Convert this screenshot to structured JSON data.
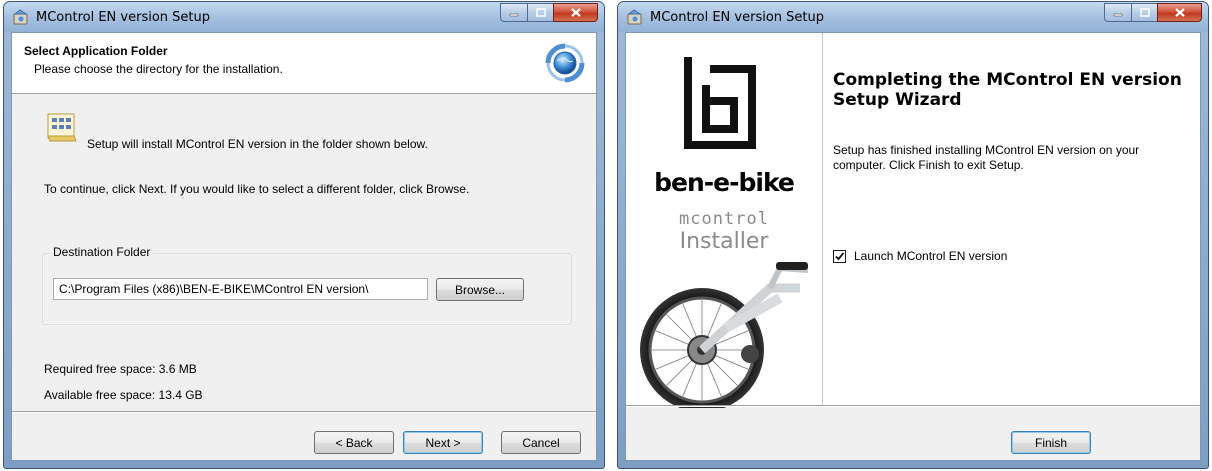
{
  "window1": {
    "title": "MControl EN version Setup",
    "header": {
      "title": "Select Application Folder",
      "subtitle": "Please choose the directory for the installation."
    },
    "intro": "Setup will install MControl EN version in the folder shown below.",
    "instruction": "To continue, click Next. If you would like to select a different folder, click Browse.",
    "destination": {
      "label": "Destination Folder",
      "path": "C:\\Program Files (x86)\\BEN-E-BIKE\\MControl EN version\\",
      "browse_label": "Browse..."
    },
    "required_space": "Required free space: 3.6 MB",
    "available_space": "Available free space: 13.4 GB",
    "buttons": {
      "back": "< Back",
      "next": "Next >",
      "cancel": "Cancel"
    }
  },
  "window2": {
    "title": "MControl EN version Setup",
    "brand": {
      "name": "ben-e-bike",
      "product": "mcontrol",
      "installer": "Installer"
    },
    "heading": "Completing the MControl EN version Setup Wizard",
    "body": "Setup has finished installing MControl EN version on your computer. Click Finish to exit Setup.",
    "launch_checkbox": {
      "label": "Launch MControl EN version",
      "checked": true
    },
    "finish_label": "Finish"
  }
}
